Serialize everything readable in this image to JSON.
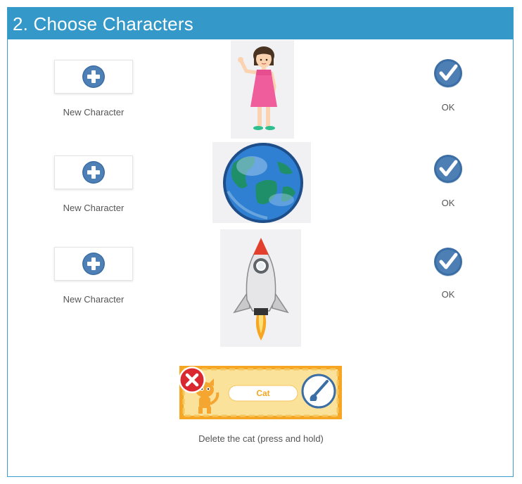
{
  "header": {
    "title": "2. Choose Characters"
  },
  "rows": [
    {
      "new_label": "New Character",
      "character_icon": "girl-sprite",
      "ok_label": "OK"
    },
    {
      "new_label": "New Character",
      "character_icon": "earth-sprite",
      "ok_label": "OK"
    },
    {
      "new_label": "New Character",
      "character_icon": "rocket-sprite",
      "ok_label": "OK"
    }
  ],
  "cat_card": {
    "name": "Cat",
    "delete_icon": "close-icon",
    "paint_icon": "paintbrush-icon"
  },
  "delete_hint": "Delete the cat (press and hold)",
  "colors": {
    "header": "#3498c8",
    "accent": "#3a6ea5",
    "orange": "#f6a623",
    "delete": "#d9282f"
  }
}
